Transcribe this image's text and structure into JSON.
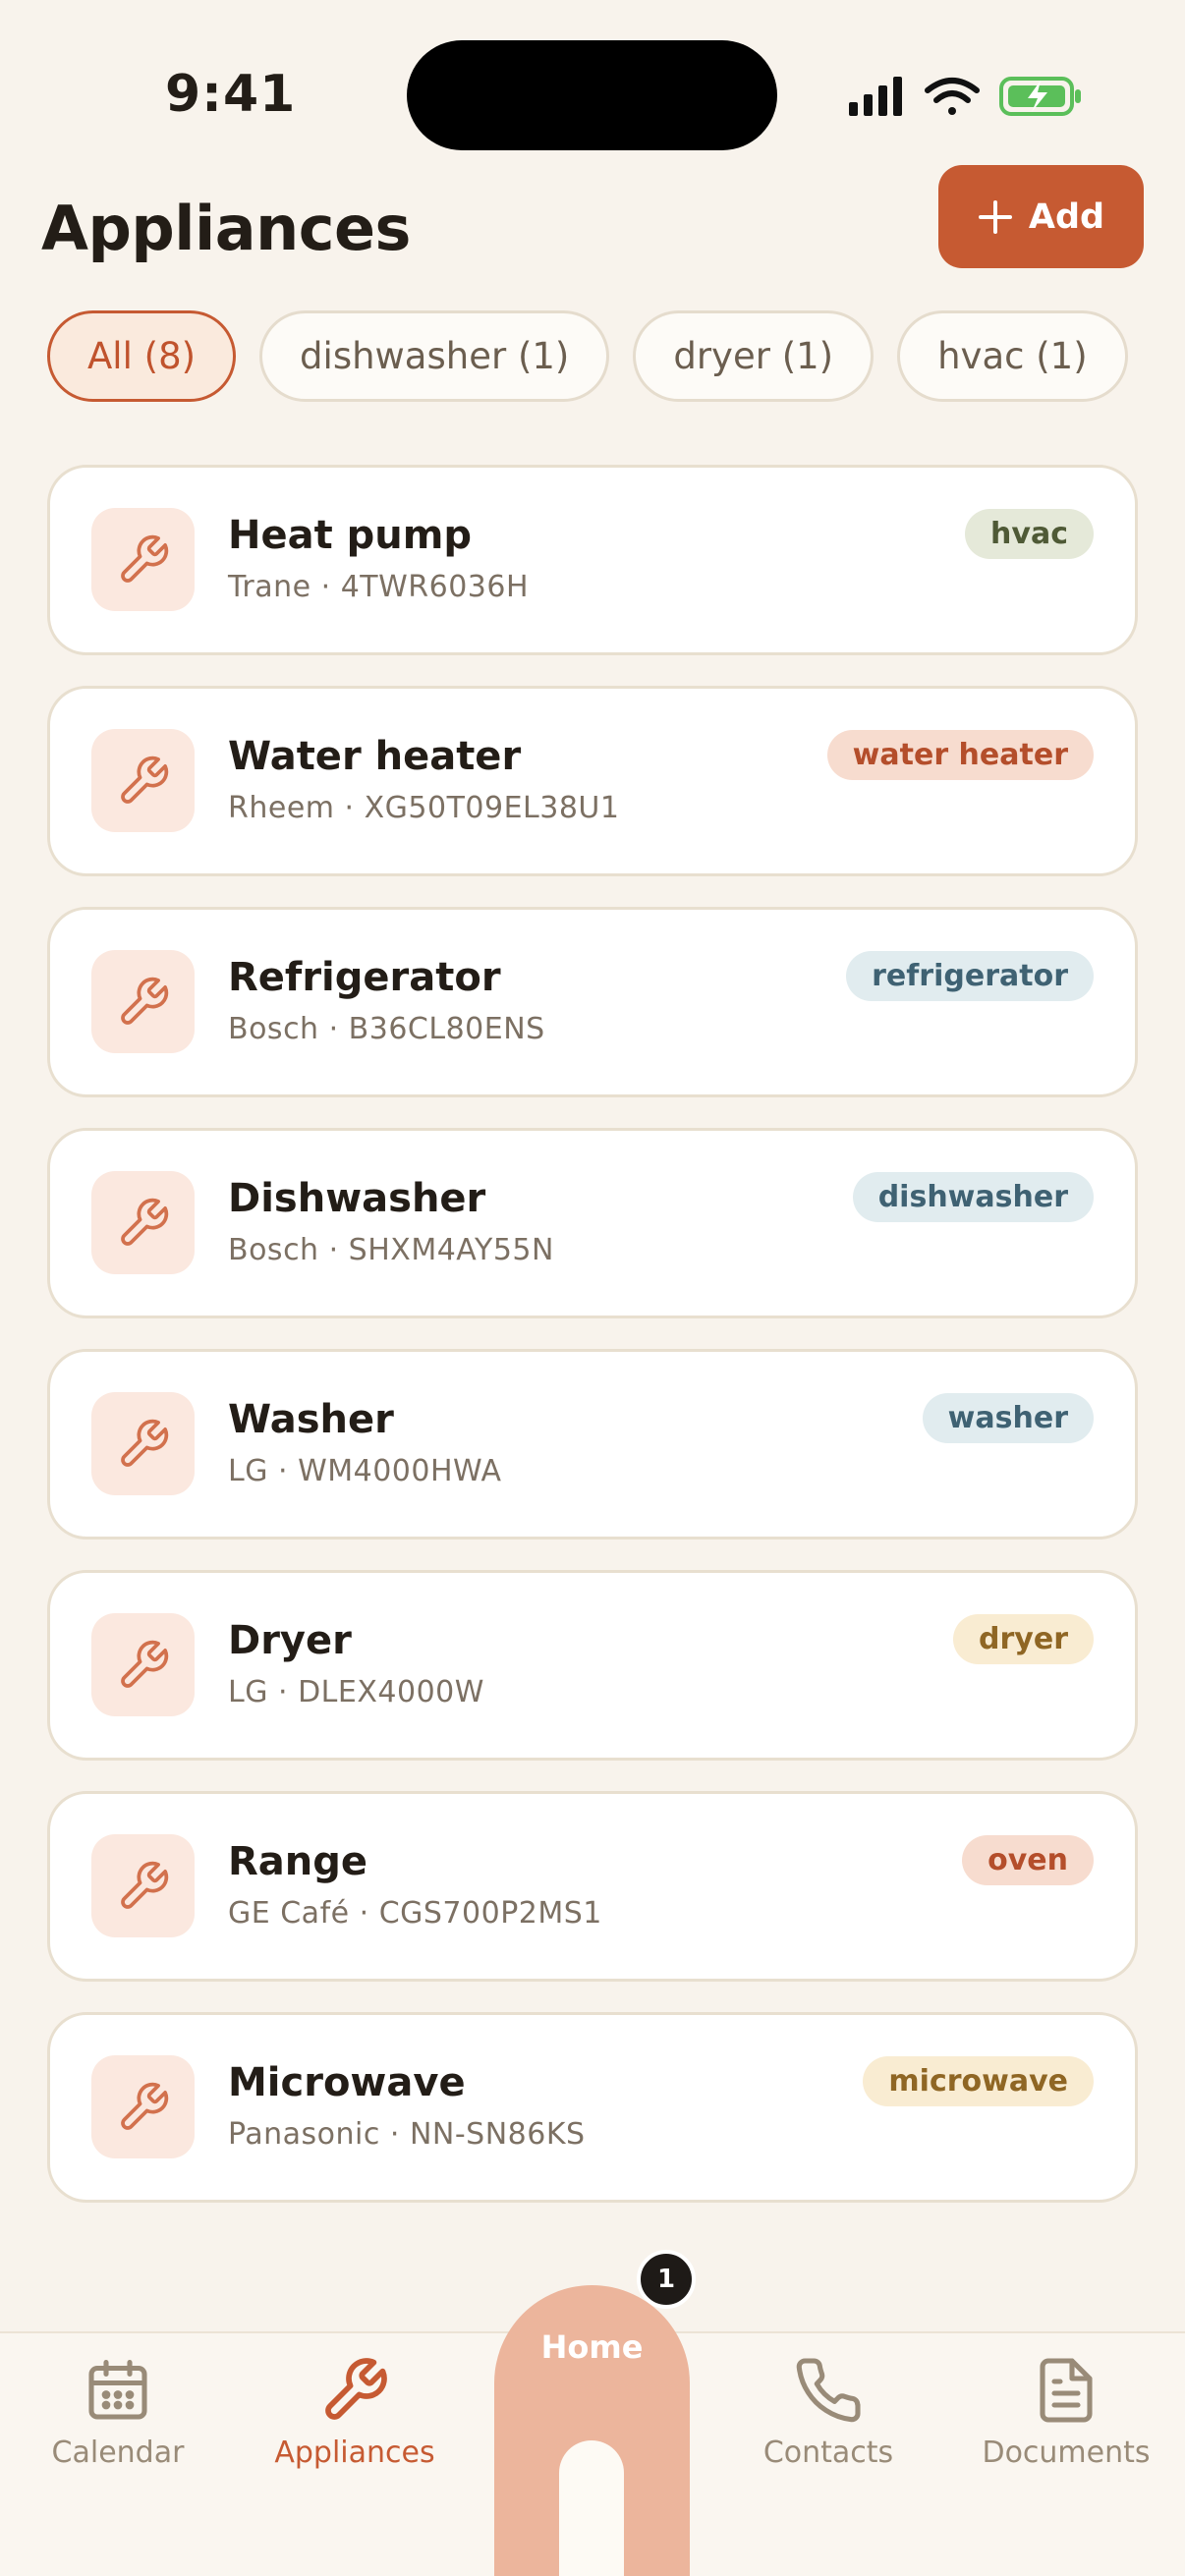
{
  "status": {
    "time": "9:41"
  },
  "header": {
    "title": "Appliances",
    "add_label": "Add"
  },
  "filters": [
    {
      "label": "All (8)",
      "active": true
    },
    {
      "label": "dishwasher (1)",
      "active": false
    },
    {
      "label": "dryer (1)",
      "active": false
    },
    {
      "label": "hvac (1)",
      "active": false
    }
  ],
  "appliances": [
    {
      "name": "Heat pump",
      "subtitle": "Trane · 4TWR6036H",
      "tag": "hvac",
      "tag_bg": "#e5e9d9",
      "tag_color": "#4f5a36",
      "icon": "wrench-icon"
    },
    {
      "name": "Water heater",
      "subtitle": "Rheem · XG50T09EL38U1",
      "tag": "water heater",
      "tag_bg": "#f7dccf",
      "tag_color": "#b44e2b",
      "icon": "wrench-icon"
    },
    {
      "name": "Refrigerator",
      "subtitle": "Bosch · B36CL80ENS",
      "tag": "refrigerator",
      "tag_bg": "#e1ecef",
      "tag_color": "#3f6273",
      "icon": "wrench-icon"
    },
    {
      "name": "Dishwasher",
      "subtitle": "Bosch · SHXM4AY55N",
      "tag": "dishwasher",
      "tag_bg": "#e1ecef",
      "tag_color": "#3f6273",
      "icon": "wrench-icon"
    },
    {
      "name": "Washer",
      "subtitle": "LG · WM4000HWA",
      "tag": "washer",
      "tag_bg": "#e1ecef",
      "tag_color": "#3f6273",
      "icon": "wrench-icon"
    },
    {
      "name": "Dryer",
      "subtitle": "LG · DLEX4000W",
      "tag": "dryer",
      "tag_bg": "#f9ecd2",
      "tag_color": "#8f6624",
      "icon": "wrench-icon"
    },
    {
      "name": "Range",
      "subtitle": "GE Café · CGS700P2MS1",
      "tag": "oven",
      "tag_bg": "#f7dccf",
      "tag_color": "#b44e2b",
      "icon": "wrench-icon"
    },
    {
      "name": "Microwave",
      "subtitle": "Panasonic · NN-SN86KS",
      "tag": "microwave",
      "tag_bg": "#f9ecd2",
      "tag_color": "#8f6624",
      "icon": "wrench-icon"
    }
  ],
  "nav": {
    "calendar": "Calendar",
    "appliances": "Appliances",
    "home": "Home",
    "home_badge": "1",
    "contacts": "Contacts",
    "documents": "Documents"
  },
  "colors": {
    "accent": "#c65a32",
    "background": "#f8f3ec",
    "home_tab": "#ecb59c"
  }
}
